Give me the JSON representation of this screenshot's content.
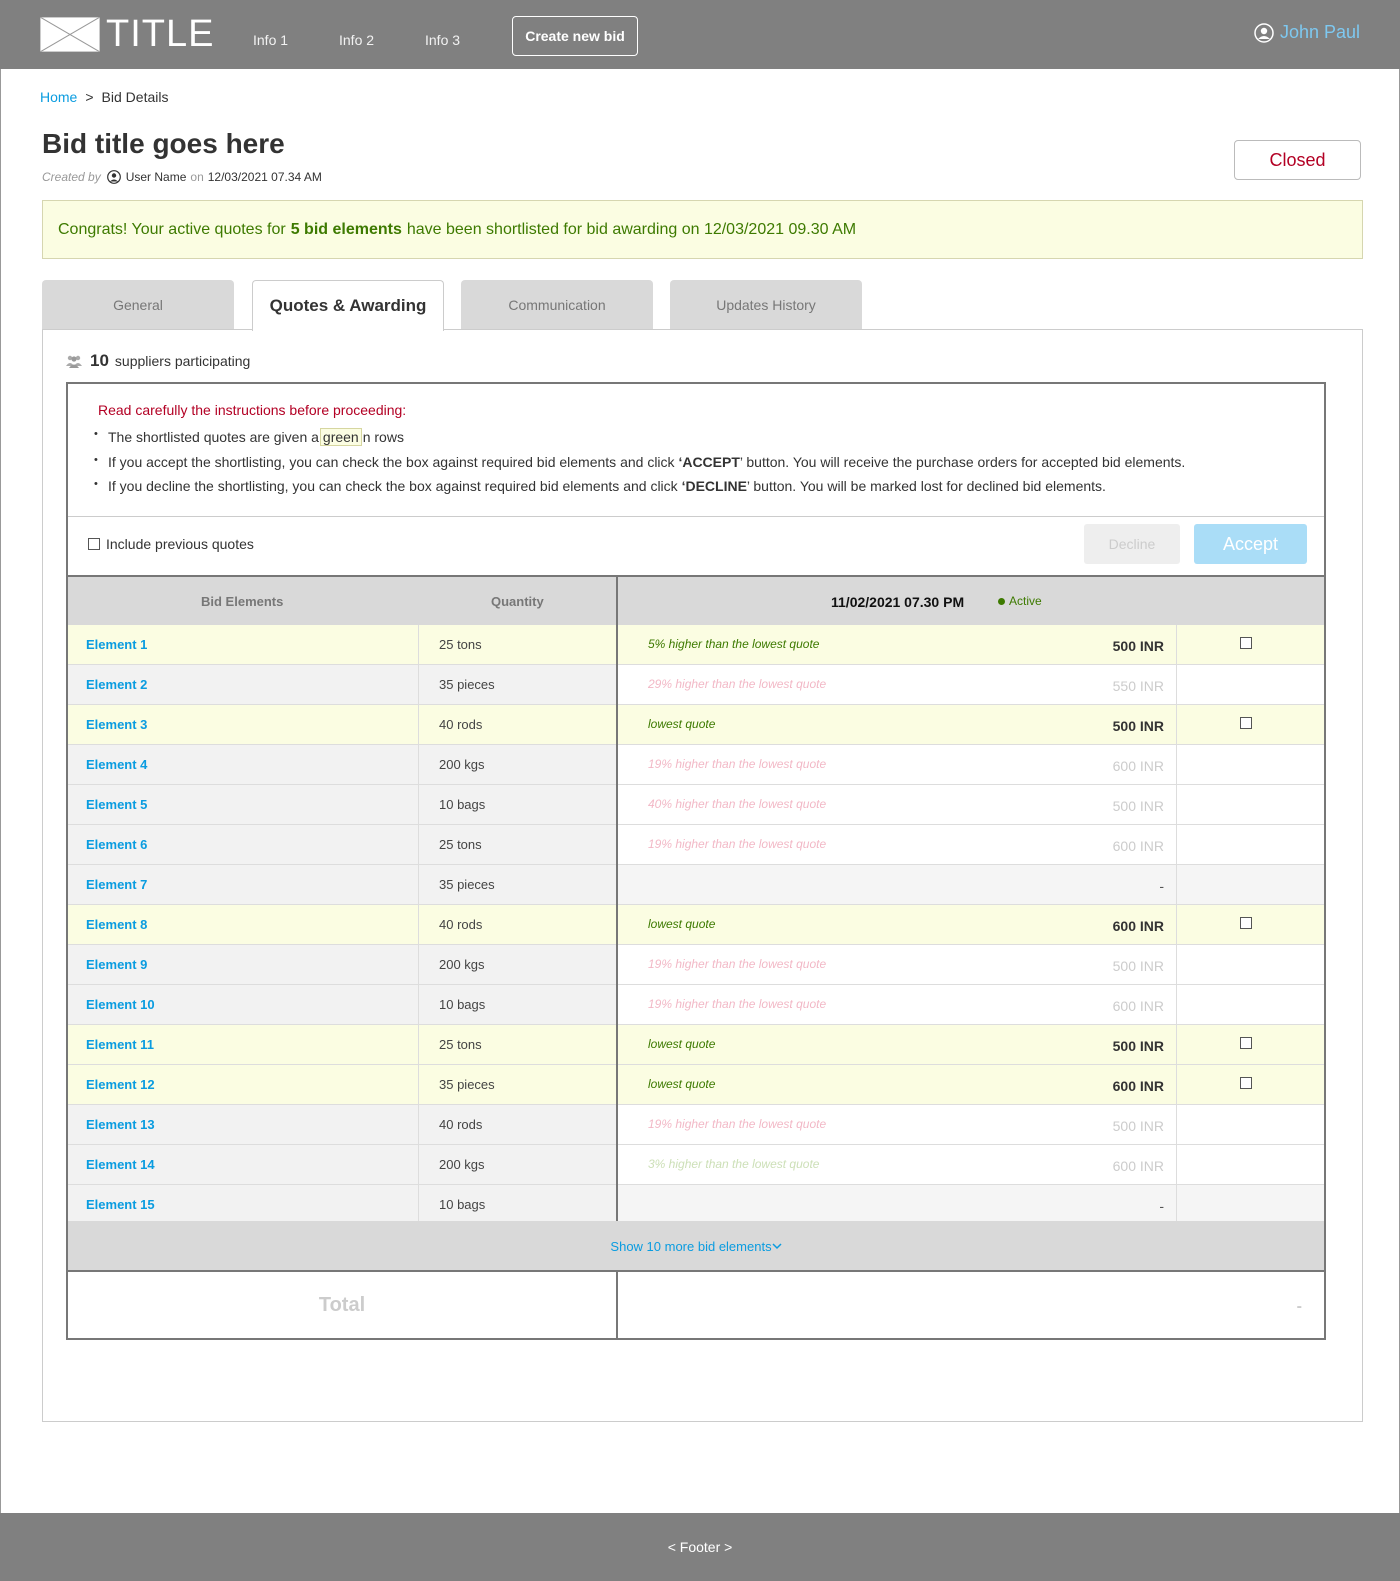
{
  "header": {
    "logo_text": "TITLE",
    "nav": [
      "Info 1",
      "Info 2",
      "Info 3"
    ],
    "create_label": "Create new bid",
    "user_name": "John Paul"
  },
  "breadcrumb": {
    "home": "Home",
    "separator": ">",
    "current": "Bid Details"
  },
  "bid": {
    "title": "Bid title goes here",
    "created_by_label": "Created by",
    "user_name": "User Name",
    "on_label": "on",
    "created_at": "12/03/2021 07.34 AM",
    "status": "Closed"
  },
  "banner": {
    "prefix": "Congrats! Your active quotes for",
    "highlight": "5 bid elements",
    "suffix": "have been shortlisted for bid awarding on 12/03/2021 09.30 AM"
  },
  "tabs": [
    "General",
    "Quotes & Awarding",
    "Communication",
    "Updates History"
  ],
  "suppliers": {
    "count": "10",
    "label": "suppliers participating"
  },
  "instructions": {
    "title": "Read carefully the instructions before proceeding:",
    "line1_prefix": "The shortlisted quotes are given a",
    "line1_chip": "green",
    "line1_suffix": "n rows",
    "line2_prefix": "If you accept the shortlisting, you can check the box against required bid elements and click",
    "line2_bold": "‘ACCEPT",
    "line2_suffix": "’ button. You will receive the purchase orders for accepted bid elements.",
    "line3_prefix": "If you decline the shortlisting, you can check the box against required bid elements and click",
    "line3_bold": "‘DECLINE",
    "line3_suffix": "’ button. You will be marked lost for declined bid elements."
  },
  "controls": {
    "include_previous": "Include previous quotes",
    "decline": "Decline",
    "accept": "Accept"
  },
  "table": {
    "col_elements": "Bid Elements",
    "col_quantity": "Quantity",
    "quote_date": "11/02/2021 07.30 PM",
    "quote_status": "Active",
    "rows": [
      {
        "name": "Element 1",
        "qty": "25 tons",
        "note": "5% higher than the lowest quote",
        "price": "500 INR",
        "state": "short"
      },
      {
        "name": "Element 2",
        "qty": "35 pieces",
        "note": "29% higher than the lowest quote",
        "price": "550 INR",
        "state": "dim"
      },
      {
        "name": "Element 3",
        "qty": "40 rods",
        "note": "lowest quote",
        "price": "500 INR",
        "state": "short"
      },
      {
        "name": "Element 4",
        "qty": "200 kgs",
        "note": "19% higher than the lowest quote",
        "price": "600 INR",
        "state": "dim"
      },
      {
        "name": "Element 5",
        "qty": "10 bags",
        "note": "40% higher than the lowest quote",
        "price": "500 INR",
        "state": "dim"
      },
      {
        "name": "Element 6",
        "qty": "25 tons",
        "note": "19% higher than the lowest quote",
        "price": "600 INR",
        "state": "dim"
      },
      {
        "name": "Element 7",
        "qty": "35 pieces",
        "note": "",
        "price": "-",
        "state": "none"
      },
      {
        "name": "Element 8",
        "qty": "40 rods",
        "note": "lowest quote",
        "price": "600 INR",
        "state": "short"
      },
      {
        "name": "Element 9",
        "qty": "200 kgs",
        "note": "19% higher than the lowest quote",
        "price": "500 INR",
        "state": "dim"
      },
      {
        "name": "Element 10",
        "qty": "10 bags",
        "note": "19% higher than the lowest quote",
        "price": "600 INR",
        "state": "dim"
      },
      {
        "name": "Element 11",
        "qty": "25 tons",
        "note": "lowest quote",
        "price": "500 INR",
        "state": "short"
      },
      {
        "name": "Element 12",
        "qty": "35 pieces",
        "note": "lowest quote",
        "price": "600 INR",
        "state": "short"
      },
      {
        "name": "Element 13",
        "qty": "40 rods",
        "note": "19% higher than the lowest quote",
        "price": "500 INR",
        "state": "dim"
      },
      {
        "name": "Element 14",
        "qty": "200 kgs",
        "note": "3% higher than the lowest quote",
        "price": "600 INR",
        "state": "dim2"
      },
      {
        "name": "Element 15",
        "qty": "10 bags",
        "note": "",
        "price": "-",
        "state": "none"
      }
    ],
    "show_more": "Show 10 more bid elements",
    "total_label": "Total",
    "total_value": "-"
  },
  "footer": "< Footer >"
}
